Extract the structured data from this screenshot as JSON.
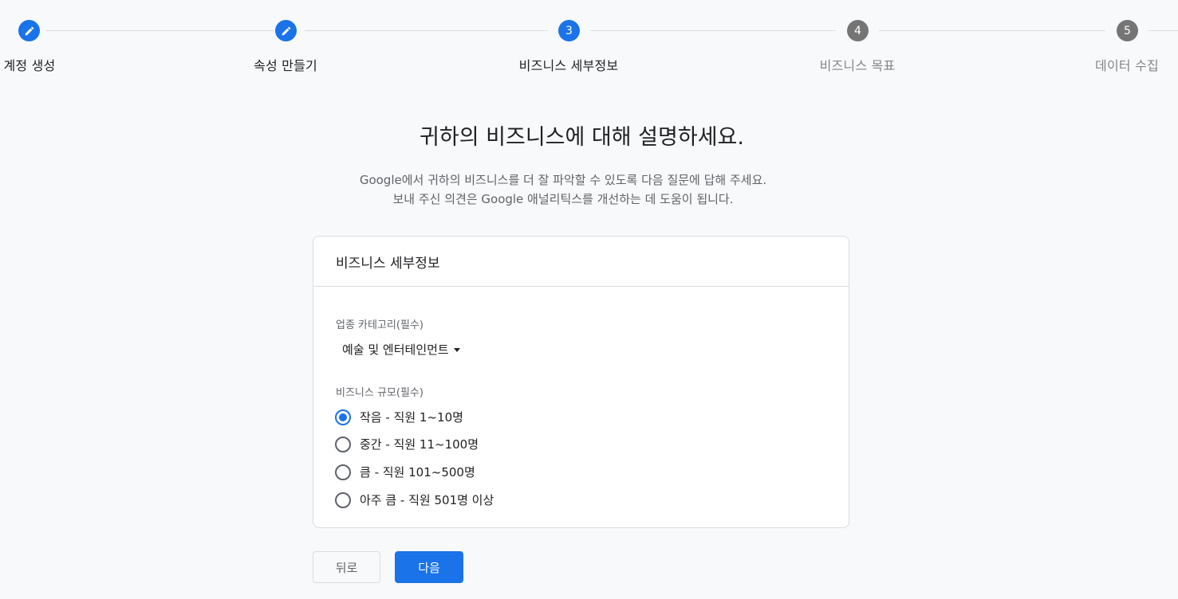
{
  "stepper": {
    "steps": [
      {
        "number": "1",
        "label": "계정 생성",
        "status": "done",
        "icon": "pencil-icon"
      },
      {
        "number": "2",
        "label": "속성 만들기",
        "status": "done",
        "icon": "pencil-icon"
      },
      {
        "number": "3",
        "label": "비즈니스 세부정보",
        "status": "current"
      },
      {
        "number": "4",
        "label": "비즈니스 목표",
        "status": "todo"
      },
      {
        "number": "5",
        "label": "데이터 수집",
        "status": "todo"
      }
    ]
  },
  "main": {
    "title": "귀하의 비즈니스에 대해 설명하세요.",
    "subtitle_line1": "Google에서 귀하의 비즈니스를 더 잘 파악할 수 있도록 다음 질문에 답해 주세요.",
    "subtitle_line2": "보내 주신 의견은 Google 애널리틱스를 개선하는 데 도움이 됩니다."
  },
  "card": {
    "header": "비즈니스 세부정보",
    "industry": {
      "label": "업종 카테고리(필수)",
      "selected": "예술 및 엔터테인먼트"
    },
    "size": {
      "label": "비즈니스 규모(필수)",
      "options": [
        {
          "label": "작음 - 직원 1~10명",
          "checked": true
        },
        {
          "label": "중간 - 직원 11~100명",
          "checked": false
        },
        {
          "label": "큼 - 직원 101~500명",
          "checked": false
        },
        {
          "label": "아주 큼 - 직원 501명 이상",
          "checked": false
        }
      ]
    }
  },
  "buttons": {
    "back": "뒤로",
    "next": "다음"
  },
  "colors": {
    "primary": "#1a73e8",
    "inactive_step": "#757575",
    "background": "#f8f9fa"
  }
}
